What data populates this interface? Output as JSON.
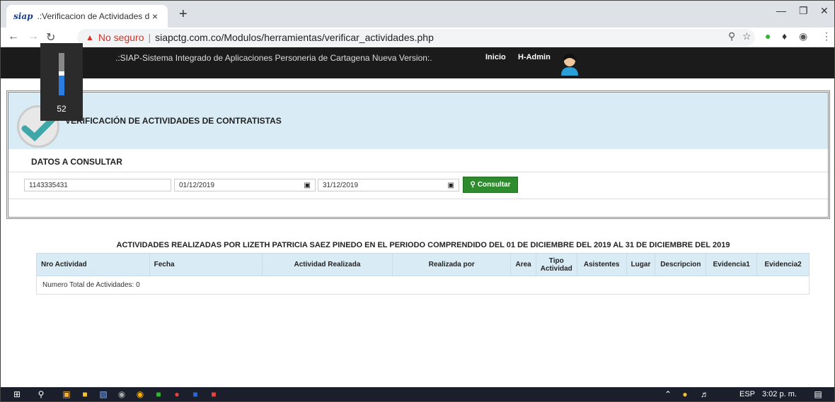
{
  "browser": {
    "tab_title": ".:Verificacion de Actividades de C",
    "favicon_text": "siap",
    "tab_close": "×",
    "new_tab": "+",
    "not_secure": "No seguro",
    "url": "siapctg.com.co/Modulos/herramientas/verificar_actividades.php"
  },
  "site": {
    "header_title": ".:SIAP-Sistema Integrado de Aplicaciones Personeria de Cartagena Nueva Version:.",
    "nav": [
      "Inicio",
      "H-Admin"
    ]
  },
  "volume": {
    "level": 52,
    "label": "52"
  },
  "panel": {
    "title": "VERIFICACIÓN DE ACTIVIDADES DE CONTRATISTAS",
    "subtitle": "DATOS A CONSULTAR",
    "fields": {
      "document": "1143335431",
      "date_from": "01/12/2019",
      "date_to": "31/12/2019"
    },
    "consultar_label": "Consultar"
  },
  "results": {
    "title": "ACTIVIDADES REALIZADAS POR LIZETH PATRICIA SAEZ PINEDO EN EL PERIODO COMPRENDIDO DEL 01 DE DICIEMBRE DEL 2019 AL 31 DE DICIEMBRE DEL 2019",
    "columns": [
      "Nro Actividad",
      "Fecha",
      "Actividad Realizada",
      "Realizada por",
      "Area",
      "Tipo Actividad",
      "Asistentes",
      "Lugar",
      "Descripcion",
      "Evidencia1",
      "Evidencia2"
    ],
    "footer": "Numero Total de Actividades: 0"
  },
  "taskbar": {
    "lang": "ESP",
    "time": "3:02 p. m."
  },
  "colors": {
    "accent_blue": "#d9ecf5",
    "button_green": "#2e8b2e",
    "warning_red": "#d93025"
  }
}
